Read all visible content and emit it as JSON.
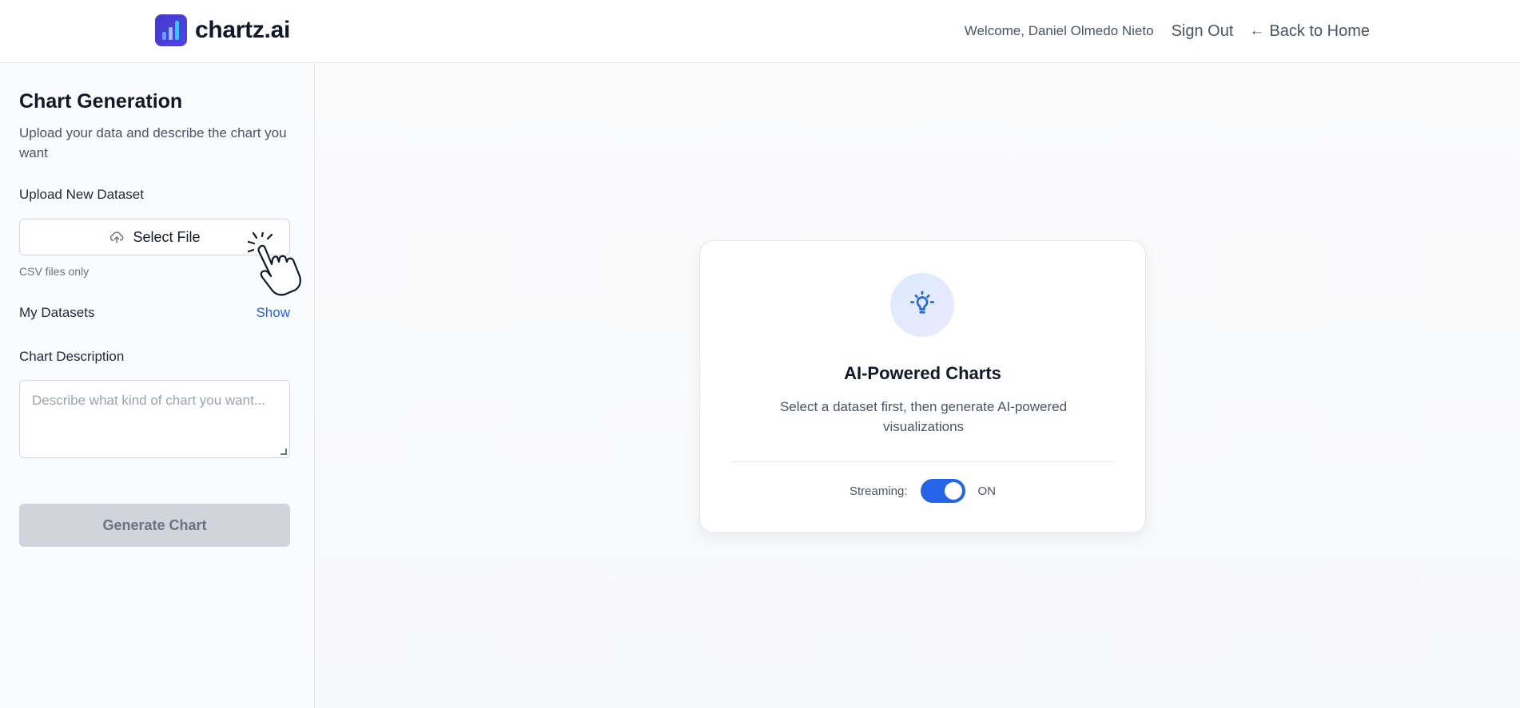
{
  "header": {
    "brand_name": "chartz.ai",
    "welcome": "Welcome, Daniel Olmedo Nieto",
    "sign_out": "Sign Out",
    "back_home": "Back to Home"
  },
  "sidebar": {
    "title": "Chart Generation",
    "subtitle": "Upload your data and describe the chart you want",
    "upload_label": "Upload New Dataset",
    "select_file": "Select File",
    "file_hint": "CSV files only",
    "datasets_label": "My Datasets",
    "datasets_toggle": "Show",
    "description_label": "Chart Description",
    "description_placeholder": "Describe what kind of chart you want...",
    "description_value": "",
    "generate_button": "Generate Chart"
  },
  "card": {
    "title": "AI-Powered Charts",
    "text": "Select a dataset first, then generate AI-powered visualizations",
    "streaming_label": "Streaming:",
    "streaming_state": "ON"
  },
  "colors": {
    "accent": "#2563eb",
    "brand": "#4338ca",
    "disabled_button": "#d1d5db"
  },
  "icons": {
    "logo": "bar-chart-logo",
    "upload": "cloud-upload-icon",
    "back": "arrow-left-icon",
    "card": "lightbulb-icon",
    "cursor": "hand-pointer-cursor"
  }
}
